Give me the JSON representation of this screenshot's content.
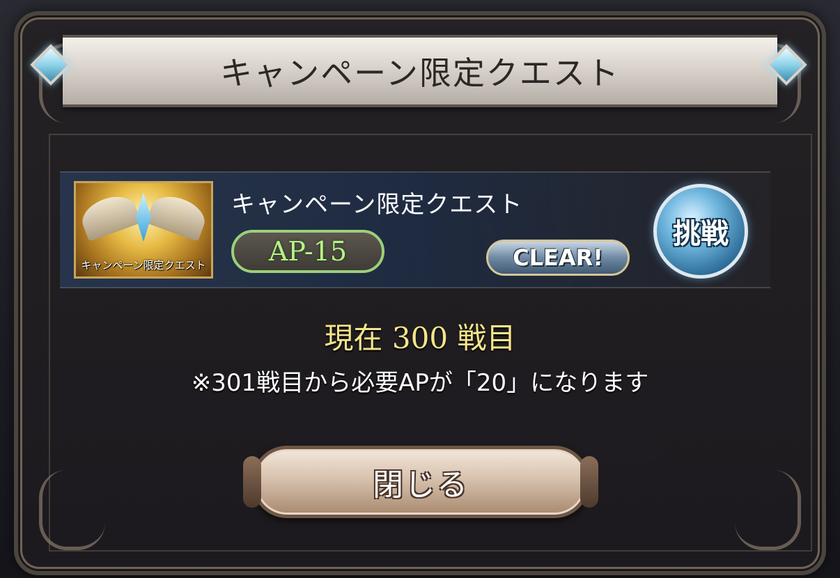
{
  "dialog": {
    "title": "キャンペーン限定クエスト"
  },
  "quest": {
    "thumbnail_label": "キャンペーン限定クエスト",
    "name": "キャンペーン限定クエスト",
    "ap_cost": "AP-15",
    "clear_badge": "CLEAR!",
    "challenge_button": "挑戦"
  },
  "status": {
    "prefix": "現在",
    "count": "300",
    "suffix": "戦目",
    "notice": "※301戦目から必要APが「20」になります"
  },
  "buttons": {
    "close": "閉じる"
  },
  "colors": {
    "ap_accent": "#9bd07a",
    "count_text": "#f6e58a",
    "gem": "#8fd3ea"
  }
}
